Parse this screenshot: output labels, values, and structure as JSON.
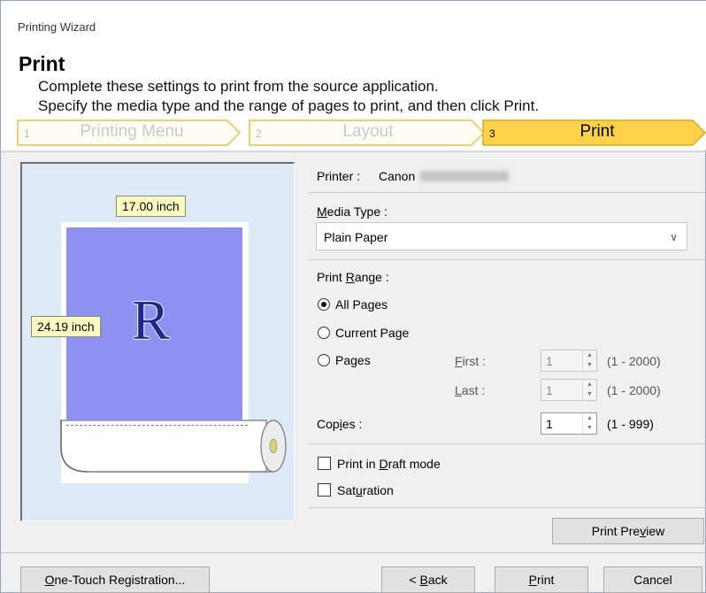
{
  "window": {
    "title": "Printing Wizard"
  },
  "header": {
    "title": "Print",
    "description_line1": "Complete these settings to print from the source application.",
    "description_line2": "Specify the media type and the range of pages to print, and then click Print."
  },
  "steps": [
    {
      "number": "1",
      "label": "Printing Menu",
      "active": false
    },
    {
      "number": "2",
      "label": "Layout",
      "active": false
    },
    {
      "number": "3",
      "label": "Print",
      "active": true
    }
  ],
  "preview": {
    "width_label": "17.00 inch",
    "height_label": "24.19 inch",
    "sample_letter": "R"
  },
  "printer": {
    "label": "Printer :",
    "name": "Canon"
  },
  "media_type": {
    "label_pre": "",
    "label_u": "M",
    "label_post": "edia Type :",
    "value": "Plain Paper"
  },
  "print_range": {
    "label_pre": "Print ",
    "label_u": "R",
    "label_post": "ange :",
    "options": [
      "All Pages",
      "Current Page",
      "Pages"
    ],
    "selected": "All Pages",
    "first": {
      "label_u": "F",
      "label_post": "irst :",
      "value": "1",
      "range": "(1 - 2000)"
    },
    "last": {
      "label_u": "L",
      "label_post": "ast :",
      "value": "1",
      "range": "(1 - 2000)"
    }
  },
  "copies": {
    "label_pre": "Cop",
    "label_u": "i",
    "label_post": "es :",
    "value": "1",
    "range": "(1 - 999)"
  },
  "options": {
    "draft": {
      "label_pre": "Print in ",
      "label_u": "D",
      "label_post": "raft mode",
      "checked": false
    },
    "saturation": {
      "label_pre": "Sat",
      "label_u": "u",
      "label_post": "ration",
      "checked": false
    }
  },
  "buttons": {
    "print_preview": {
      "pre": "Print Pre",
      "u": "v",
      "post": "iew"
    },
    "one_touch": {
      "pre": "",
      "u": "O",
      "post": "ne-Touch Registration..."
    },
    "back": {
      "pre": "< ",
      "u": "B",
      "post": "ack"
    },
    "print": {
      "pre": "",
      "u": "P",
      "post": "rint"
    },
    "cancel": {
      "label": "Cancel"
    }
  },
  "colors": {
    "active_step": "#ffd24a",
    "inactive_step_border": "#e6c04a",
    "preview_bg": "#dde9f7",
    "print_area": "#8e90f2"
  }
}
